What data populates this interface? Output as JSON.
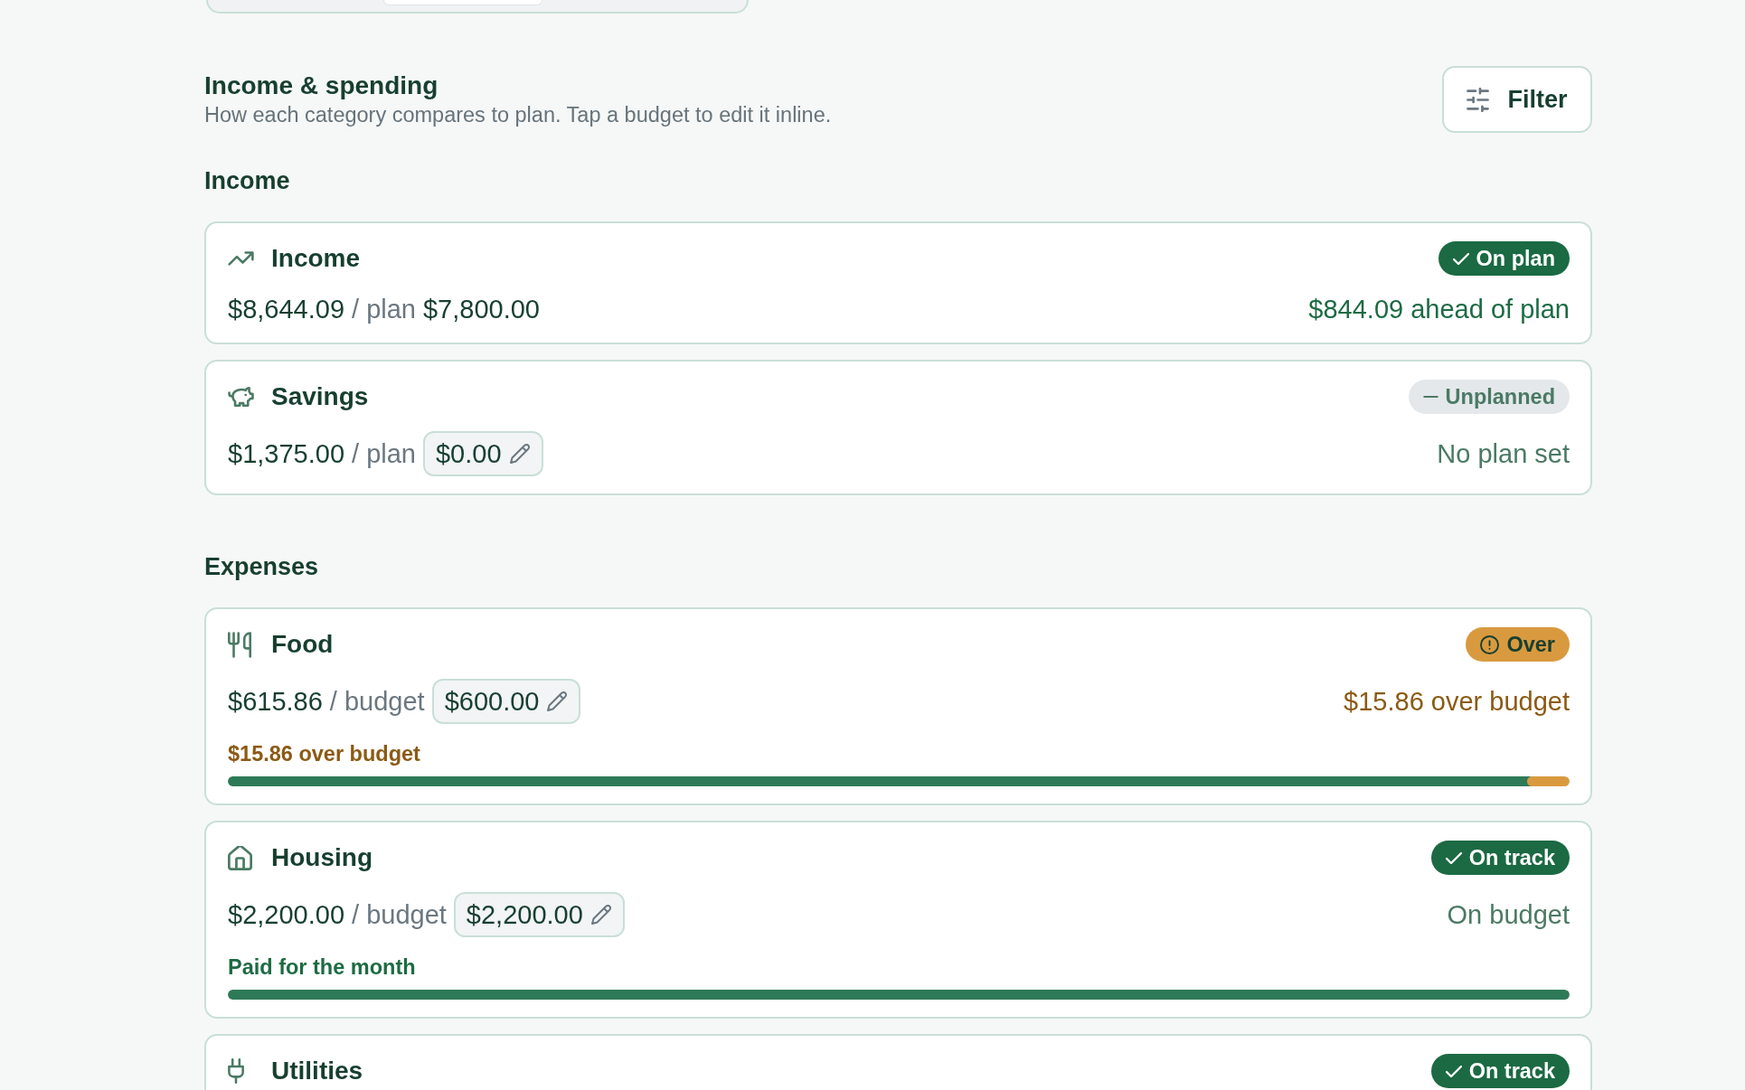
{
  "view_switcher": {
    "segments": [
      {
        "selected": false
      },
      {
        "selected": true
      },
      {
        "selected": false
      }
    ]
  },
  "header": {
    "title": "Income & spending",
    "subtitle": "How each category compares to plan. Tap a budget to edit it inline.",
    "filter_button": "Filter"
  },
  "sections": [
    {
      "heading": "Income",
      "categories": [
        {
          "kind": "income",
          "name": "Income",
          "badge": {
            "label": "On plan",
            "kind": "ok"
          },
          "actual": "$8,644.09",
          "plan_label": "/ plan",
          "plan": {
            "value": "$7,800.00",
            "editable": false
          },
          "summary": {
            "text": "$844.09 ahead of plan",
            "kind": "positive"
          }
        },
        {
          "kind": "savings",
          "name": "Savings",
          "badge": {
            "label": "Unplanned",
            "kind": "neutral"
          },
          "actual": "$1,375.00",
          "plan_label": "/ plan",
          "plan": {
            "value": "$0.00",
            "editable": true
          },
          "summary": {
            "text": "No plan set",
            "kind": "muted"
          }
        }
      ]
    },
    {
      "heading": "Expenses",
      "categories": [
        {
          "kind": "food",
          "name": "Food",
          "badge": {
            "label": "Over",
            "kind": "warning"
          },
          "actual": "$615.86",
          "plan_label": "/ budget",
          "plan": {
            "value": "$600.00",
            "editable": true
          },
          "summary": {
            "text": "$15.86 over budget",
            "kind": "warning"
          },
          "note": {
            "text": "$15.86 over budget",
            "kind": "warning"
          },
          "progress": {
            "level": 0.974,
            "over": true
          }
        },
        {
          "kind": "housing",
          "name": "Housing",
          "badge": {
            "label": "On track",
            "kind": "ok"
          },
          "actual": "$2,200.00",
          "plan_label": "/ budget",
          "plan": {
            "value": "$2,200.00",
            "editable": true
          },
          "summary": {
            "text": "On budget",
            "kind": "muted"
          },
          "note": {
            "text": "Paid for the month",
            "kind": "positive"
          },
          "progress": {
            "level": 1,
            "over": false
          }
        },
        {
          "kind": "utilities",
          "name": "Utilities",
          "badge": {
            "label": "On track",
            "kind": "ok"
          }
        }
      ]
    }
  ]
}
